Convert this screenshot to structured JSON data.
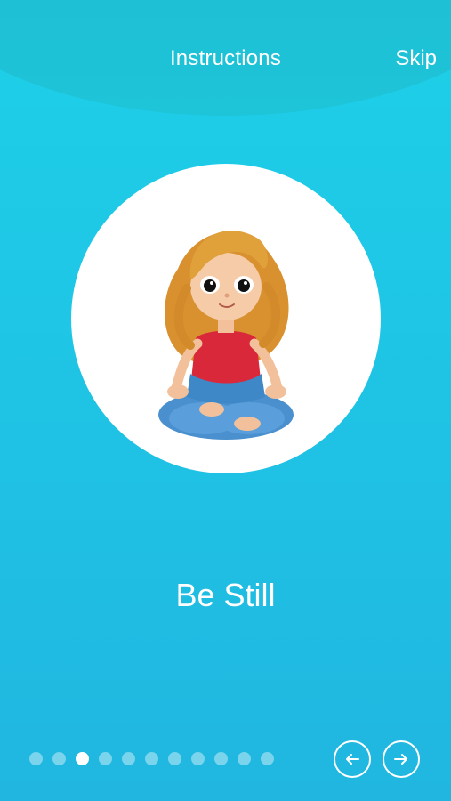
{
  "header": {
    "title": "Instructions",
    "skip_label": "Skip"
  },
  "step": {
    "caption": "Be Still",
    "illustration": "girl-meditating-cross-legged"
  },
  "pager": {
    "total": 11,
    "current": 3
  },
  "nav": {
    "prev_icon": "arrow-left-icon",
    "next_icon": "arrow-right-icon"
  },
  "colors": {
    "accent": "#1ec8e6",
    "header": "#1cbcd2"
  }
}
